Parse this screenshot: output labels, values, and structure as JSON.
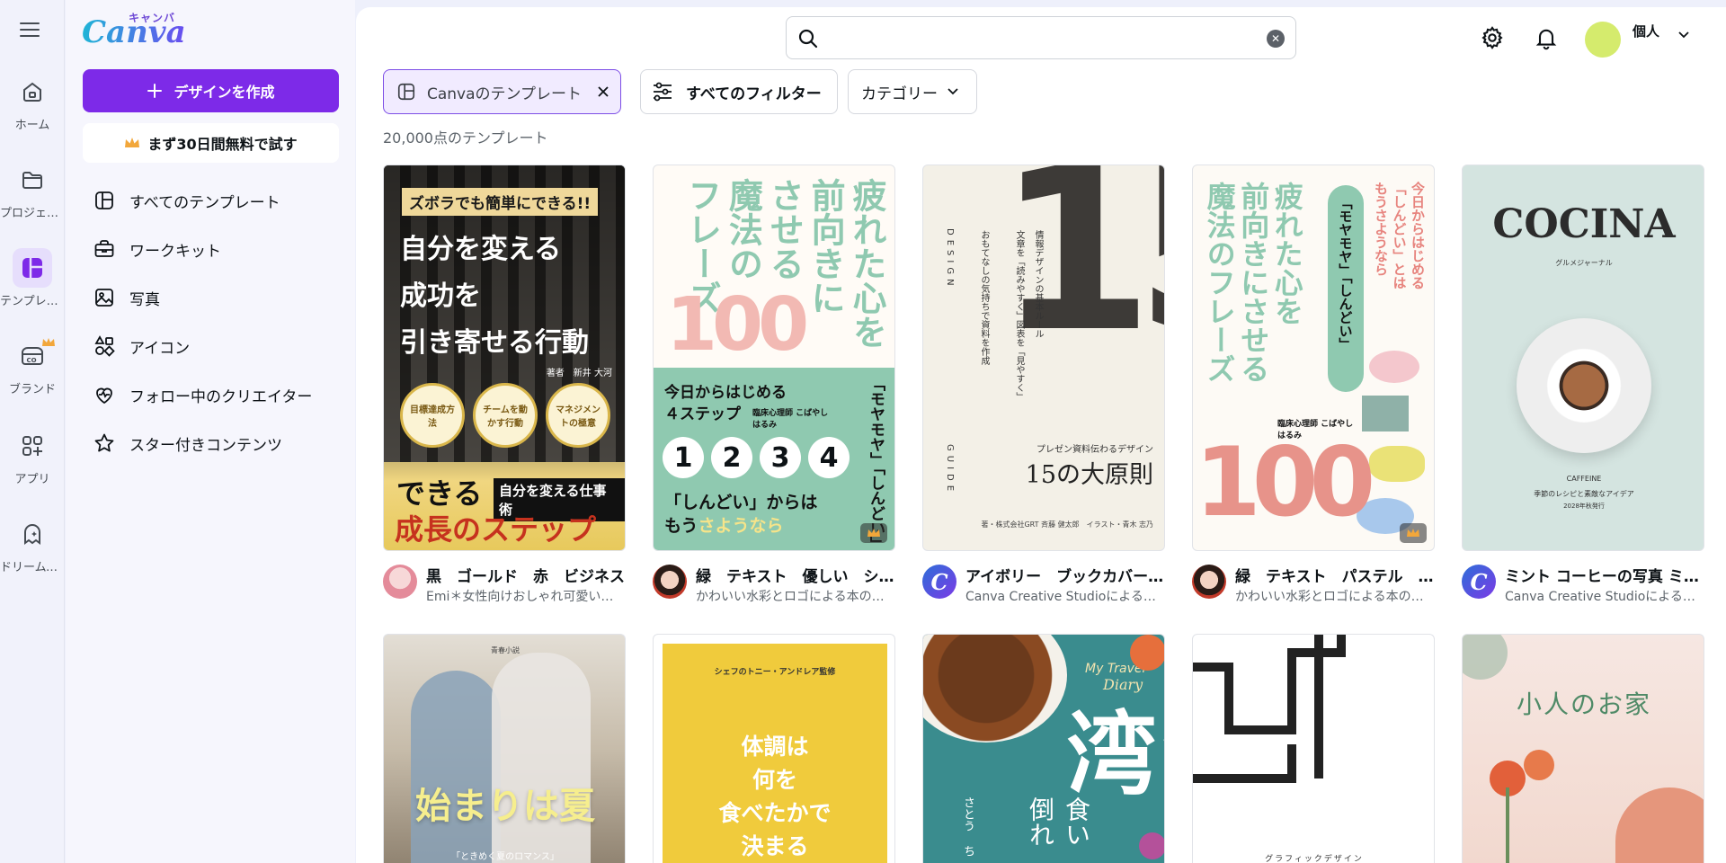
{
  "rail": {
    "items": [
      {
        "label": "ホーム",
        "icon": "home-icon"
      },
      {
        "label": "プロジェクト",
        "icon": "folder-icon"
      },
      {
        "label": "テンプレート",
        "icon": "templates-icon"
      },
      {
        "label": "ブランド",
        "icon": "brand-icon"
      },
      {
        "label": "アプリ",
        "icon": "apps-icon"
      },
      {
        "label": "ドリームラボ",
        "icon": "dream-lab-icon"
      }
    ]
  },
  "brand": {
    "word": "Canva",
    "kana": "キャンバ"
  },
  "panel": {
    "create_label": "デザインを作成",
    "trial_label": "まず30日間無料で試す",
    "nav": [
      {
        "label": "すべてのテンプレート",
        "icon": "template-icon"
      },
      {
        "label": "ワークキット",
        "icon": "briefcase-icon"
      },
      {
        "label": "写真",
        "icon": "photo-icon"
      },
      {
        "label": "アイコン",
        "icon": "shapes-icon"
      },
      {
        "label": "フォロー中のクリエイター",
        "icon": "heart-pulse-icon"
      },
      {
        "label": "スター付きコンテンツ",
        "icon": "star-icon"
      }
    ]
  },
  "search": {
    "value": "",
    "placeholder": ""
  },
  "account": {
    "label": "個人",
    "avatar_color": "#d5eb6d"
  },
  "filters": {
    "selected_chip": "Canvaのテンプレート",
    "all_filters": "すべてのフィルター",
    "category": "カテゴリー"
  },
  "results": {
    "count": "20,000点のテンプレート"
  },
  "cards": [
    {
      "title": "黒　ゴールド　赤　ビジネス",
      "author": "Emi＊女性向けおしゃれ可愛いデザイン",
      "lines": {
        "tag": "ズボラでも簡単にできる!!",
        "h1": "自分を変える",
        "h2": "成功を",
        "h3": "引き寄せる行動",
        "byline": "著者　新井 大河",
        "b1": "目標達成方法",
        "b2": "チームを動かす行動",
        "b3": "マネジメントの極意",
        "bottom1": "できる",
        "bottom_tag": "自分を変える仕事術",
        "bottom2": "成長のステップ"
      }
    },
    {
      "title": "緑　テキスト　優しい　シンプル",
      "author": "かわいい水彩とロゴによる本の表紙",
      "lines": {
        "v1": "疲れた心を",
        "v2": "前向きに",
        "v3": "させる",
        "v4": "魔法の",
        "v5": "フレーズ",
        "num": "100",
        "s1": "今日からはじめる",
        "s2": "４ステップ",
        "auth": "臨床心理師 こばやしはるみ",
        "d1": "1",
        "d2": "2",
        "d3": "3",
        "d4": "4",
        "q1": "「しんどい」からは",
        "q2": "もう",
        "q3": "さようなら",
        "side": "「モヤモヤ」「しんどい」"
      }
    },
    {
      "title": "アイボリー　ブックカバー　シンプル",
      "author": "Canva Creative Studioによる本の表紙",
      "lines": {
        "num": "15",
        "design": "DESIGN",
        "guide": "GUIDE",
        "v1": "情報デザインの基本ルール",
        "v2": "文章を「読みやすく」図表を「見やすく」",
        "v3": "おもてなしの気持ちで資料を作成",
        "sub": "プレゼン資料伝わるデザイン",
        "main": "15の大原則",
        "credit": "著・株式会社GRT 斉藤 健太郎　イラスト・青木 志乃"
      }
    },
    {
      "title": "緑　テキスト　パステル　かわいい",
      "author": "かわいい水彩とロゴによる本の表紙",
      "lines": {
        "r1": "今日からはじめる",
        "r2": "「しんどい」とは",
        "r3": "もうさようなら",
        "pill": "「モヤモヤ」「しんどい」",
        "v1": "疲れた心を",
        "v2": "前向きにさせる",
        "v3": "魔法のフレーズ",
        "auth": "臨床心理師 こばやしはるみ",
        "num": "100"
      }
    },
    {
      "title": "ミント コーヒーの写真 ミニマル",
      "author": "Canva Creative Studioによる本の表紙",
      "lines": {
        "title": "COCINA",
        "sub": "グルメジャーナル",
        "c1": "CAFFEINE",
        "c2": "季節のレシピと素敵なアイデア",
        "c3": "2028年秋発行"
      }
    }
  ],
  "cards_row2": [
    {
      "small": "青春小説",
      "main": "始まりは夏",
      "sub": "「ときめく夏のロマンス」"
    },
    {
      "top": "シェフのトニー・アンドレア監修",
      "l1": "体調は",
      "l2": "何を",
      "l3": "食べたかで",
      "l4": "決まる"
    },
    {
      "t1": "My Travel",
      "t2": "Diary",
      "big": "台湾",
      "v": "食い倒れ",
      "author": "さとう ち"
    },
    {
      "bottom": "グラフィックデザイン"
    },
    {
      "title": "小人のお家"
    }
  ],
  "colors": {
    "accent": "#7d2ae8",
    "selected_chip_border": "#7d4ee6",
    "mint": "#8fc9b0",
    "salmon": "#e99890",
    "teal": "#3a8c8e",
    "yellow": "#f0cb3c"
  }
}
